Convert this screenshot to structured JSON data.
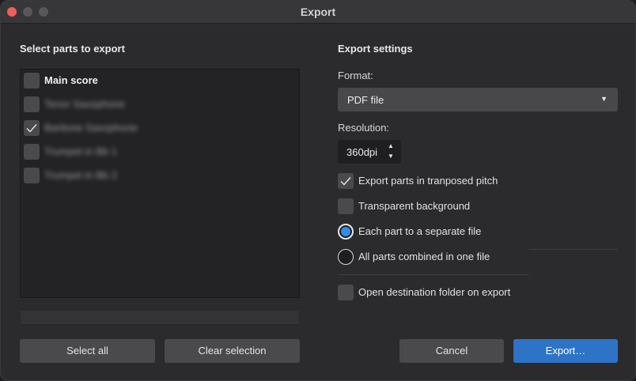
{
  "window": {
    "title": "Export"
  },
  "parts": {
    "heading": "Select parts to export",
    "items": [
      {
        "label": "Main score",
        "checked": false,
        "obscured": false
      },
      {
        "label": "Tenor Saxophone",
        "checked": false,
        "obscured": true
      },
      {
        "label": "Baritone Saxophone",
        "checked": true,
        "obscured": true
      },
      {
        "label": "Trumpet in Bb 1",
        "checked": false,
        "obscured": true
      },
      {
        "label": "Trumpet in Bb 2",
        "checked": false,
        "obscured": true
      }
    ],
    "select_all_label": "Select all",
    "clear_selection_label": "Clear selection"
  },
  "settings": {
    "heading": "Export settings",
    "format_label": "Format:",
    "format_value": "PDF file",
    "resolution_label": "Resolution:",
    "resolution_value": "360dpi",
    "transposed_label": "Export parts in tranposed pitch",
    "transposed_checked": true,
    "transparent_label": "Transparent background",
    "transparent_checked": false,
    "separate_label": "Each part to a separate file",
    "combined_label": "All parts combined in one file",
    "selected_mode": "separate",
    "open_folder_label": "Open destination folder on export",
    "open_folder_checked": false
  },
  "footer": {
    "cancel_label": "Cancel",
    "export_label": "Export…"
  },
  "colors": {
    "accent": "#2d74c7",
    "radio_dot": "#2f8de4",
    "close_button": "#ee5f59"
  }
}
